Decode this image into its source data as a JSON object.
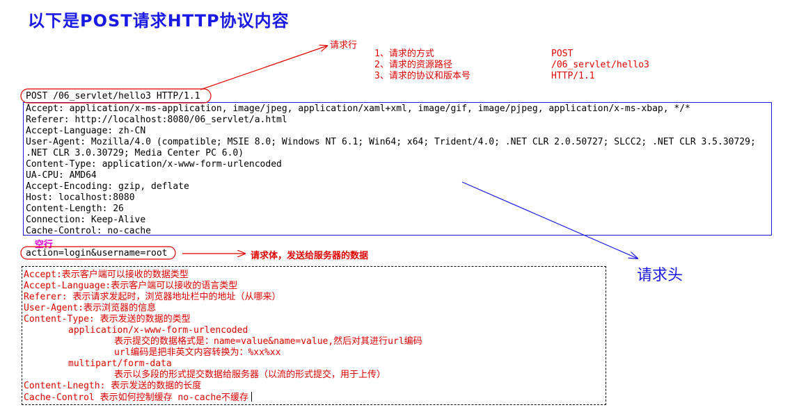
{
  "title": "以下是POST请求HTTP协议内容",
  "request_line": {
    "label": "请求行",
    "text": "POST /06_servlet/hello3 HTTP/1.1",
    "items": [
      {
        "desc": "1、请求的方式",
        "value": "POST"
      },
      {
        "desc": "2、请求的资源路径",
        "value": "/06_servlet/hello3"
      },
      {
        "desc": "3、请求的协议和版本号",
        "value": "HTTP/1.1"
      }
    ]
  },
  "request_headers": {
    "label": "请求头",
    "lines": [
      "Accept: application/x-ms-application, image/jpeg, application/xaml+xml, image/gif, image/pjpeg, application/x-ms-xbap, */*",
      "Referer: http://localhost:8080/06_servlet/a.html",
      "Accept-Language: zh-CN",
      "User-Agent: Mozilla/4.0 (compatible; MSIE 8.0; Windows NT 6.1; Win64; x64; Trident/4.0; .NET CLR 2.0.50727; SLCC2; .NET CLR 3.5.30729;",
      ".NET CLR 3.0.30729; Media Center PC 6.0)",
      "Content-Type: application/x-www-form-urlencoded",
      "UA-CPU: AMD64",
      "Accept-Encoding: gzip, deflate",
      "Host: localhost:8080",
      "Content-Length: 26",
      "Connection: Keep-Alive",
      "Cache-Control: no-cache"
    ]
  },
  "blank_line_label": "空行",
  "request_body": {
    "text": "action=login&username=root",
    "label": "请求体，发送给服务器的数据"
  },
  "explanations": [
    "Accept:表示客户端可以接收的数据类型",
    "Accept-Language:表示客户端可以接收的语言类型",
    "Referer: 表示请求发起时，浏览器地址栏中的地址（从哪来）",
    "User-Agent:表示浏览器的信息",
    "Content-Type: 表示发送的数据的类型",
    "application/x-www-form-urlencoded",
    "表示提交的数据格式是：name=value&name=value,然后对其进行url编码",
    "url编码是把非英文内容转换为：%xx%xx",
    "multipart/form-data",
    "表示以多段的形式提交数据给服务器（以流的形式提交，用于上传）",
    "Content-Lnegth: 表示发送的数据的长度",
    "Cache-Control 表示如何控制缓存 no-cache不缓存"
  ],
  "colors": {
    "title": "#1a1ae6",
    "annotation": "#e00000",
    "header_box": "#1a1ae6",
    "blank_line": "#e000e0"
  }
}
